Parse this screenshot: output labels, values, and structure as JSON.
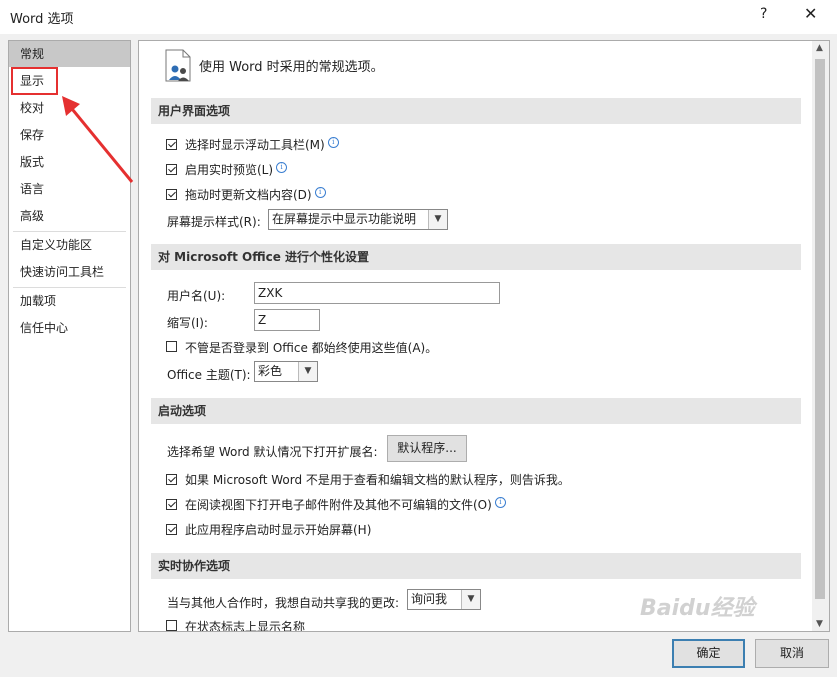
{
  "window": {
    "title": "Word 选项",
    "help": "?",
    "close": "✕"
  },
  "sidebar": {
    "items": [
      {
        "label": "常规"
      },
      {
        "label": "显示"
      },
      {
        "label": "校对"
      },
      {
        "label": "保存"
      },
      {
        "label": "版式"
      },
      {
        "label": "语言"
      },
      {
        "label": "高级"
      },
      {
        "label": "自定义功能区"
      },
      {
        "label": "快速访问工具栏"
      },
      {
        "label": "加载项"
      },
      {
        "label": "信任中心"
      }
    ],
    "selected": "常规"
  },
  "content": {
    "header": "使用 Word 时采用的常规选项。",
    "sections": [
      {
        "title": "用户界面选项"
      },
      {
        "title": "对 Microsoft Office 进行个性化设置"
      },
      {
        "title": "启动选项"
      },
      {
        "title": "实时协作选项"
      }
    ],
    "ui_options": {
      "mini_toolbar": {
        "label": "选择时显示浮动工具栏(M)",
        "checked": true
      },
      "live_preview": {
        "label": "启用实时预览(L)",
        "checked": true
      },
      "drag_update": {
        "label": "拖动时更新文档内容(D)",
        "checked": true
      },
      "screentip_label": "屏幕提示样式(R):",
      "screentip_value": "在屏幕提示中显示功能说明"
    },
    "personalize": {
      "username_label": "用户名(U):",
      "username_value": "ZXK",
      "initials_label": "缩写(I):",
      "initials_value": "Z",
      "always_use": {
        "label": "不管是否登录到 Office 都始终使用这些值(A)。",
        "checked": false
      },
      "theme_label": "Office 主题(T):",
      "theme_value": "彩色"
    },
    "startup": {
      "ext_label": "选择希望 Word 默认情况下打开扩展名:",
      "default_programs": "默认程序...",
      "tell_me": {
        "label": "如果 Microsoft Word 不是用于查看和编辑文档的默认程序，则告诉我。",
        "checked": true
      },
      "open_reading": {
        "label": "在阅读视图下打开电子邮件附件及其他不可编辑的文件(O)",
        "checked": true
      },
      "show_start": {
        "label": "此应用程序启动时显示开始屏幕(H)",
        "checked": true
      }
    },
    "collab": {
      "share_label": "当与其他人合作时，我想自动共享我的更改:",
      "share_value": "询问我",
      "show_names": {
        "label": "在状态标志上显示名称",
        "checked": false
      }
    }
  },
  "footer": {
    "ok": "确定",
    "cancel": "取消"
  },
  "watermark": "Baidu经验",
  "colors": {
    "annotation": "#e53030",
    "selected": "#c8c8c8",
    "section": "#e6e6e6"
  }
}
